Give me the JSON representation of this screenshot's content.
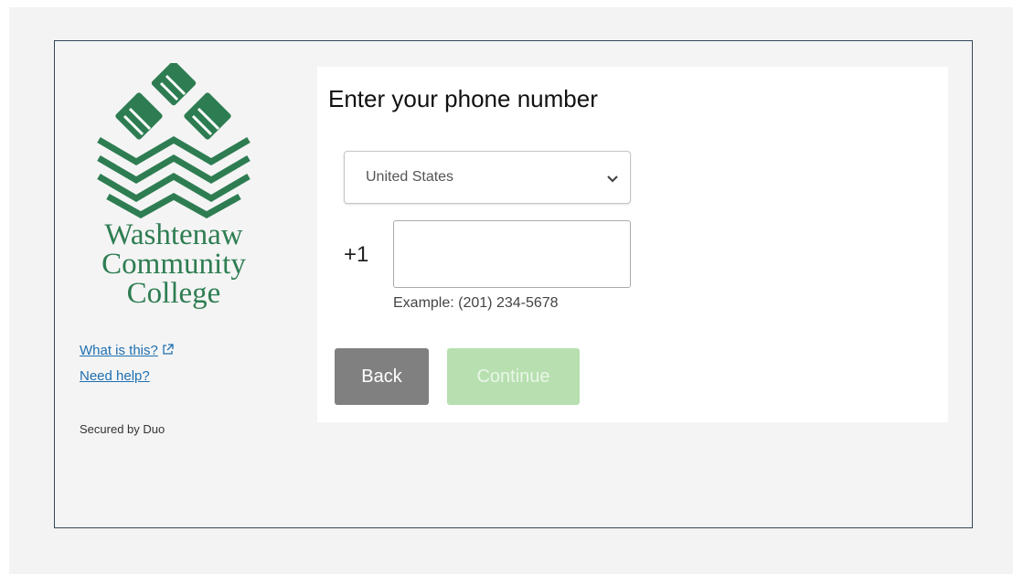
{
  "brand": {
    "name_lines": [
      "Washtenaw",
      "Community",
      "College"
    ],
    "color": "#2e7d52"
  },
  "sidebar": {
    "links": [
      {
        "label": "What is this?",
        "icon": "external-link-icon"
      },
      {
        "label": "Need help?"
      }
    ],
    "secured_by": "Secured by Duo"
  },
  "form": {
    "title": "Enter your phone number",
    "country": {
      "selected": "United States",
      "icon": "chevron-down-icon"
    },
    "phone": {
      "prefix": "+1",
      "value": "",
      "example": "Example: (201) 234-5678"
    },
    "buttons": {
      "back_label": "Back",
      "continue_label": "Continue",
      "continue_enabled": false
    }
  },
  "colors": {
    "frame_border": "#33475b",
    "link": "#1f6fb0",
    "back_button": "#808080",
    "continue_button_disabled": "#b7dfb0"
  }
}
